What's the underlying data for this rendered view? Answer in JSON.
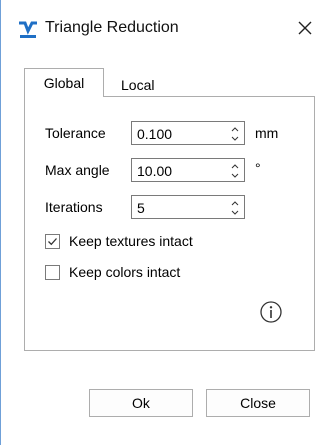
{
  "window": {
    "title": "Triangle Reduction",
    "icon": "app-logo-icon",
    "close_icon": "close-icon"
  },
  "tabs": [
    {
      "label": "Global",
      "selected": true
    },
    {
      "label": "Local",
      "selected": false
    }
  ],
  "fields": {
    "tolerance": {
      "label": "Tolerance",
      "value": "0.100",
      "unit": "mm"
    },
    "max_angle": {
      "label": "Max angle",
      "value": "10.00",
      "unit": "°"
    },
    "iterations": {
      "label": "Iterations",
      "value": "5"
    }
  },
  "options": {
    "keep_textures": {
      "label": "Keep textures intact",
      "checked": true
    },
    "keep_colors": {
      "label": "Keep colors intact",
      "checked": false
    }
  },
  "buttons": {
    "ok": "Ok",
    "close": "Close"
  },
  "colors": {
    "accent": "#1f6fc5",
    "border": "#adadad"
  }
}
